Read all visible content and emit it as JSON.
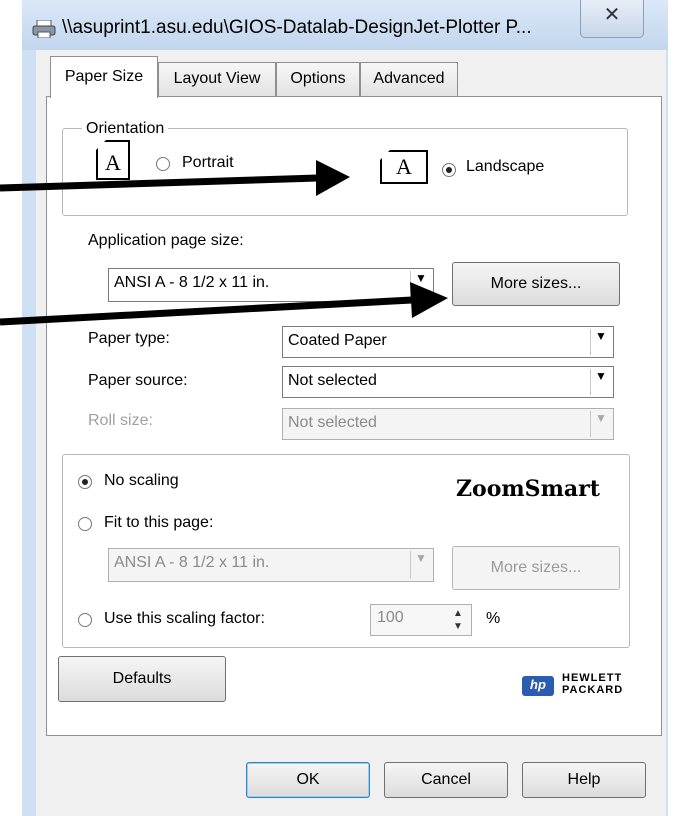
{
  "window": {
    "title": "\\\\asuprint1.asu.edu\\GIOS-Datalab-DesignJet-Plotter P...",
    "close_glyph": "✕"
  },
  "tabs": [
    {
      "label": "Paper Size",
      "active": true
    },
    {
      "label": "Layout View",
      "active": false
    },
    {
      "label": "Options",
      "active": false
    },
    {
      "label": "Advanced",
      "active": false
    }
  ],
  "orientation": {
    "legend": "Orientation",
    "portrait_label": "Portrait",
    "landscape_label": "Landscape",
    "selected": "Landscape",
    "page_glyph": "A"
  },
  "page_size": {
    "label": "Application page size:",
    "value": "ANSI A - 8 1/2 x 11 in.",
    "more_sizes": "More sizes..."
  },
  "paper_type": {
    "label": "Paper type:",
    "value": "Coated Paper"
  },
  "paper_source": {
    "label": "Paper source:",
    "value": "Not selected"
  },
  "roll_size": {
    "label": "Roll size:",
    "value": "Not selected",
    "disabled": true
  },
  "scaling": {
    "no_scaling": "No scaling",
    "fit_to_page": "Fit to this page:",
    "fit_value": "ANSI A - 8 1/2 x 11 in.",
    "fit_more_sizes": "More sizes...",
    "use_factor": "Use this scaling factor:",
    "factor_value": "100",
    "percent": "%",
    "selected": "No scaling",
    "brand": "ZoomSmart"
  },
  "buttons": {
    "defaults": "Defaults",
    "ok": "OK",
    "cancel": "Cancel",
    "help": "Help"
  },
  "logo": {
    "line1": "HEWLETT",
    "line2": "PACKARD",
    "mark": "hp"
  },
  "colors": {
    "annotation_arrow": "#000000",
    "window_frame": "#cfe0f4"
  }
}
